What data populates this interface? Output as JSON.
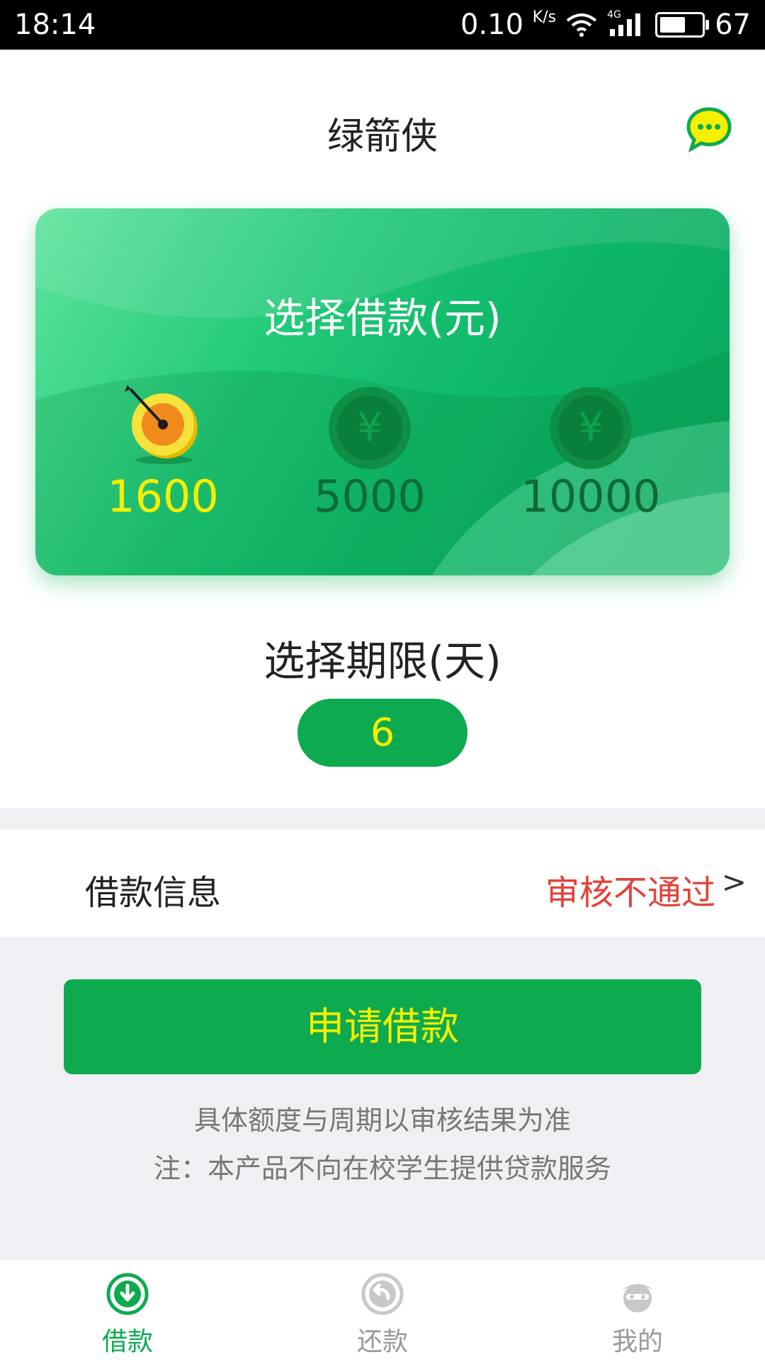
{
  "status_bar": {
    "time": "18:14",
    "speed": "0.10",
    "speed_unit": "K/s",
    "network": "4G",
    "battery": "67",
    "battery_fill": 0.67
  },
  "header": {
    "title": "绿箭侠",
    "chat_icon": "chat-bubble-icon"
  },
  "card": {
    "title": "选择借款(元)",
    "amounts": [
      {
        "label": "1600",
        "selected": true,
        "icon": "target-arrow-icon"
      },
      {
        "label": "5000",
        "selected": false,
        "icon": "yuan-coin-icon"
      },
      {
        "label": "10000",
        "selected": false,
        "icon": "yuan-coin-icon"
      }
    ],
    "yuan_symbol": "¥"
  },
  "period": {
    "title": "选择期限(天)",
    "value": "6"
  },
  "loan_info": {
    "label": "借款信息",
    "status": "审核不通过",
    "arrow": ">"
  },
  "apply": {
    "button_label": "申请借款",
    "note1": "具体额度与周期以审核结果为准",
    "note2": "注：本产品不向在校学生提供贷款服务"
  },
  "tabs": [
    {
      "label": "借款",
      "icon": "download-circle-icon",
      "active": true
    },
    {
      "label": "还款",
      "icon": "return-circle-icon",
      "active": false
    },
    {
      "label": "我的",
      "icon": "profile-icon",
      "active": false
    }
  ],
  "colors": {
    "brand_green": "#0daa50",
    "highlight_yellow": "#f5f000",
    "error_red": "#e1433a"
  }
}
